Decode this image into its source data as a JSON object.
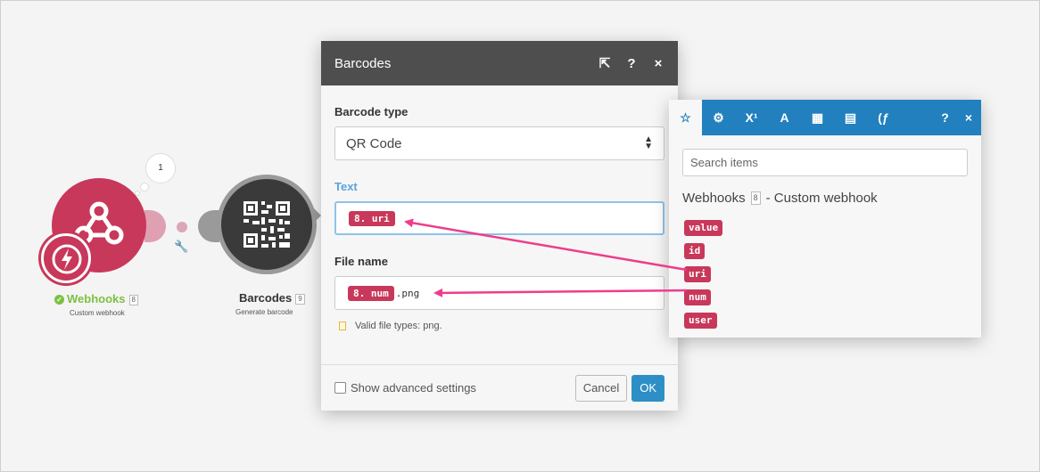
{
  "scenario": {
    "webhooks_module": {
      "label": "Webhooks",
      "id": "8",
      "subtitle": "Custom webhook",
      "bubble_count": "1",
      "status": "ok"
    },
    "barcodes_module": {
      "label": "Barcodes",
      "id": "9",
      "subtitle": "Generate barcode"
    }
  },
  "dialog": {
    "title": "Barcodes",
    "barcode_type": {
      "label": "Barcode type",
      "value": "QR Code"
    },
    "text_field": {
      "label": "Text",
      "pill": "8. uri"
    },
    "filename_field": {
      "label": "File name",
      "pill": "8. num",
      "suffix": ".png",
      "hint": "Valid file types: png."
    },
    "footer": {
      "advanced_label": "Show advanced settings",
      "cancel_label": "Cancel",
      "ok_label": "OK"
    }
  },
  "panel": {
    "tabs": [
      "star-icon",
      "gear-icon",
      "superscript-icon",
      "text-icon",
      "calendar-icon",
      "table-icon",
      "function-icon"
    ],
    "help_label": "?",
    "close_label": "×",
    "search_placeholder": "Search items",
    "module_name": "Webhooks",
    "module_id": "8",
    "module_desc": "- Custom webhook",
    "items": [
      "value",
      "id",
      "uri",
      "num",
      "user"
    ]
  },
  "colors": {
    "accent_blue": "#2280be",
    "pill_red": "#c8385a",
    "dialog_header": "#4e4e4e",
    "success_green": "#7cc142"
  }
}
